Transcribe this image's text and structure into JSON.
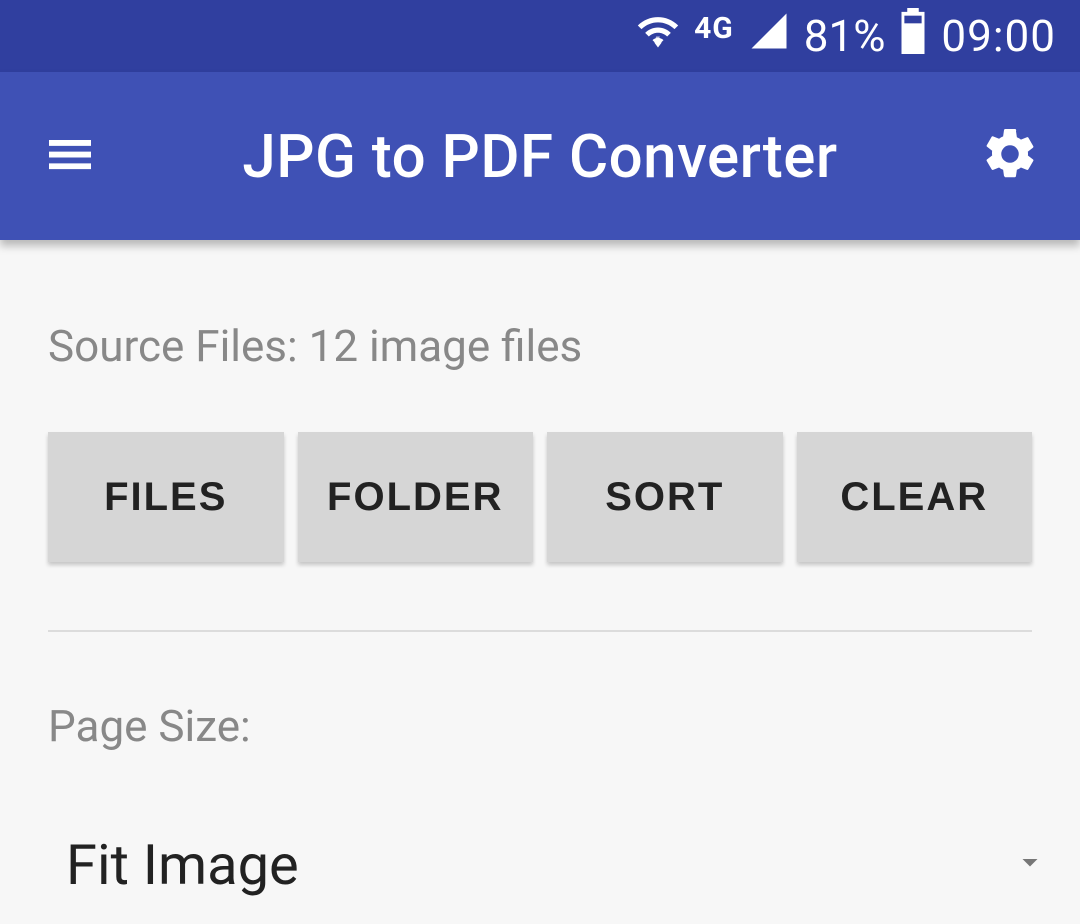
{
  "status_bar": {
    "network_type": "4G",
    "battery_percent": "81%",
    "time": "09:00"
  },
  "app_bar": {
    "title": "JPG to PDF Converter"
  },
  "source": {
    "label": "Source Files: 12 image files",
    "buttons": {
      "files": "FILES",
      "folder": "FOLDER",
      "sort": "SORT",
      "clear": "CLEAR"
    }
  },
  "page_size": {
    "label": "Page Size:",
    "value": "Fit Image"
  }
}
